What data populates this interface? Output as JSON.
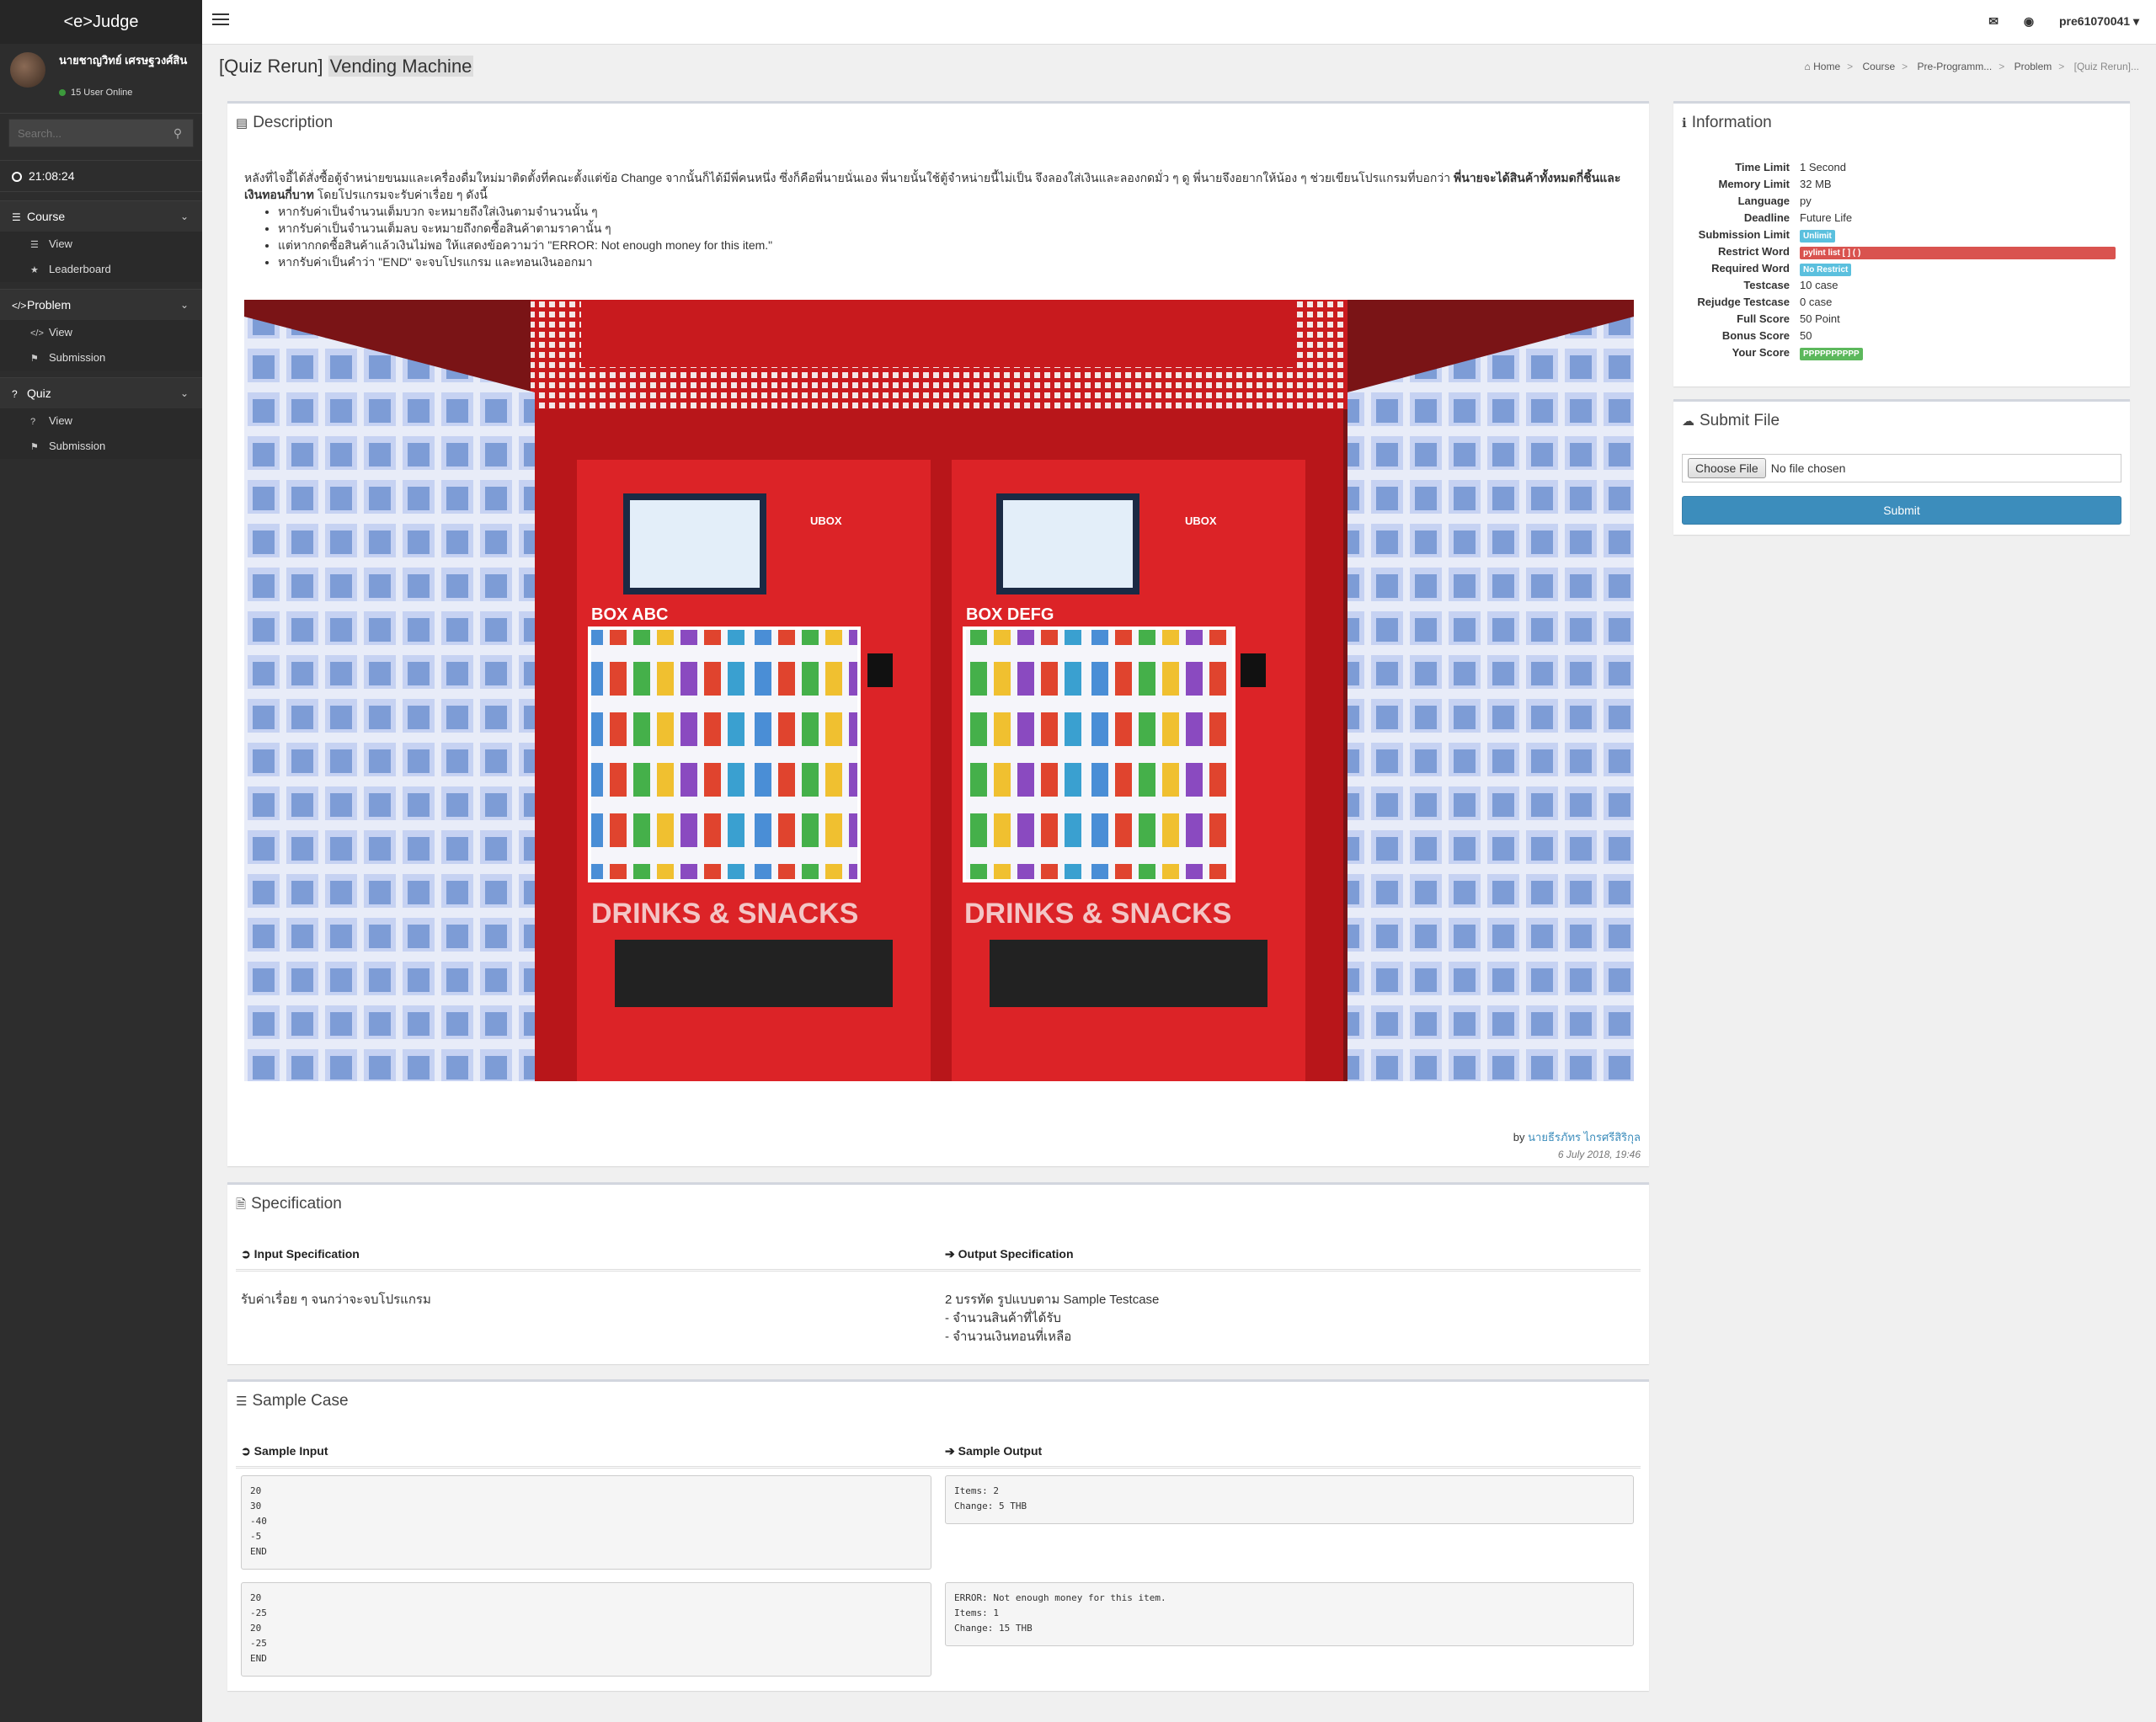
{
  "app": {
    "brand": "<e>Judge"
  },
  "user": {
    "name": "นายชาญวิทย์ เศรษฐวงศ์สิน",
    "online_text": "15 User Online",
    "account": "pre61070041"
  },
  "sidebar": {
    "search_placeholder": "Search...",
    "clock": "21:08:24",
    "sections": [
      {
        "label": "Course",
        "items": [
          "View",
          "Leaderboard"
        ]
      },
      {
        "label": "Problem",
        "items": [
          "View",
          "Submission"
        ]
      },
      {
        "label": "Quiz",
        "items": [
          "View",
          "Submission"
        ]
      }
    ]
  },
  "page": {
    "title_prefix": "[Quiz Rerun]",
    "title": "Vending Machine",
    "breadcrumb": [
      "Home",
      "Course",
      "Pre-Programm...",
      "Problem",
      "[Quiz Rerun]..."
    ]
  },
  "description": {
    "heading": "Description",
    "intro_a": "หลังที่ไจอี้ได้สั่งซื้อตู้จำหน่ายขนมและเครื่องดื่มใหม่มาติดตั้งที่คณะตั้งแต่ข้อ Change จากนั้นก็ได้มีพี่คนหนึ่ง ซึ่งก็คือพี่นายนั่นเอง พี่นายนั้นใช้ตู้จำหน่ายนี้ไม่เป็น จึงลองใส่เงินและลองกดมั่ว ๆ ดู พี่นายจึงอยากให้น้อง ๆ ช่วยเขียนโปรแกรมที่บอกว่า",
    "intro_bold": "พี่นายจะได้สินค้าทั้งหมดกี่ชิ้นและเงินทอนกี่บาท",
    "intro_b": " โดยโปรแกรมจะรับค่าเรื่อย ๆ ดังนี้",
    "bullets": [
      "หากรับค่าเป็นจำนวนเต็มบวก จะหมายถึงใส่เงินตามจำนวนนั้น ๆ",
      "หากรับค่าเป็นจำนวนเต็มลบ จะหมายถึงกดซื้อสินค้าตามราคานั้น ๆ",
      "แต่หากกดซื้อสินค้าแล้วเงินไม่พอ ให้แสดงข้อความว่า \"ERROR: Not enough money for this item.\"",
      "หากรับค่าเป็นคำว่า \"END\" จะจบโปรแกรม และทอนเงินออกมา"
    ],
    "photo_text": {
      "left_box": "BOX ABC",
      "right_box": "BOX DEFG",
      "slogan": "DRINKS & SNACKS",
      "ubox": "UBOX"
    },
    "author_prefix": "by",
    "author": "นายธีรภัทร ไกรศรีสิริกุล",
    "date": "6 July 2018, 19:46"
  },
  "specification": {
    "heading": "Specification",
    "input_label": "Input Specification",
    "output_label": "Output Specification",
    "input_text": "รับค่าเรื่อย ๆ จนกว่าจะจบโปรแกรม",
    "output_text": "2 บรรทัด รูปแบบตาม Sample Testcase\n- จำนวนสินค้าที่ได้รับ\n- จำนวนเงินทอนที่เหลือ"
  },
  "samples": {
    "heading": "Sample Case",
    "input_label": "Sample Input",
    "output_label": "Sample Output",
    "cases": [
      {
        "input": "20\n30\n-40\n-5\nEND",
        "output": "Items: 2\nChange: 5 THB"
      },
      {
        "input": "20\n-25\n20\n-25\nEND",
        "output": "ERROR: Not enough money for this item.\nItems: 1\nChange: 15 THB"
      }
    ]
  },
  "information": {
    "heading": "Information",
    "rows": [
      {
        "label": "Time Limit",
        "value": "1 Second"
      },
      {
        "label": "Memory Limit",
        "value": "32 MB"
      },
      {
        "label": "Language",
        "value": "py"
      },
      {
        "label": "Deadline",
        "value": "Future Life"
      },
      {
        "label": "Submission Limit",
        "value": "Unlimit",
        "badge": "#5bc0de"
      },
      {
        "label": "Restrict Word",
        "value": "pylint list [ ] ( )",
        "badge": "#d9534f"
      },
      {
        "label": "Required Word",
        "value": "No Restrict",
        "badge": "#5bc0de"
      },
      {
        "label": "Testcase",
        "value": "10 case"
      },
      {
        "label": "Rejudge Testcase",
        "value": "0 case"
      },
      {
        "label": "Full Score",
        "value": "50 Point"
      },
      {
        "label": "Bonus Score",
        "value": "50"
      },
      {
        "label": "Your Score",
        "value": "PPPPPPPPPP",
        "badge": "#5cb85c"
      }
    ]
  },
  "submit": {
    "heading": "Submit File",
    "choose_label": "Choose File",
    "no_file": "No file chosen",
    "button": "Submit"
  }
}
